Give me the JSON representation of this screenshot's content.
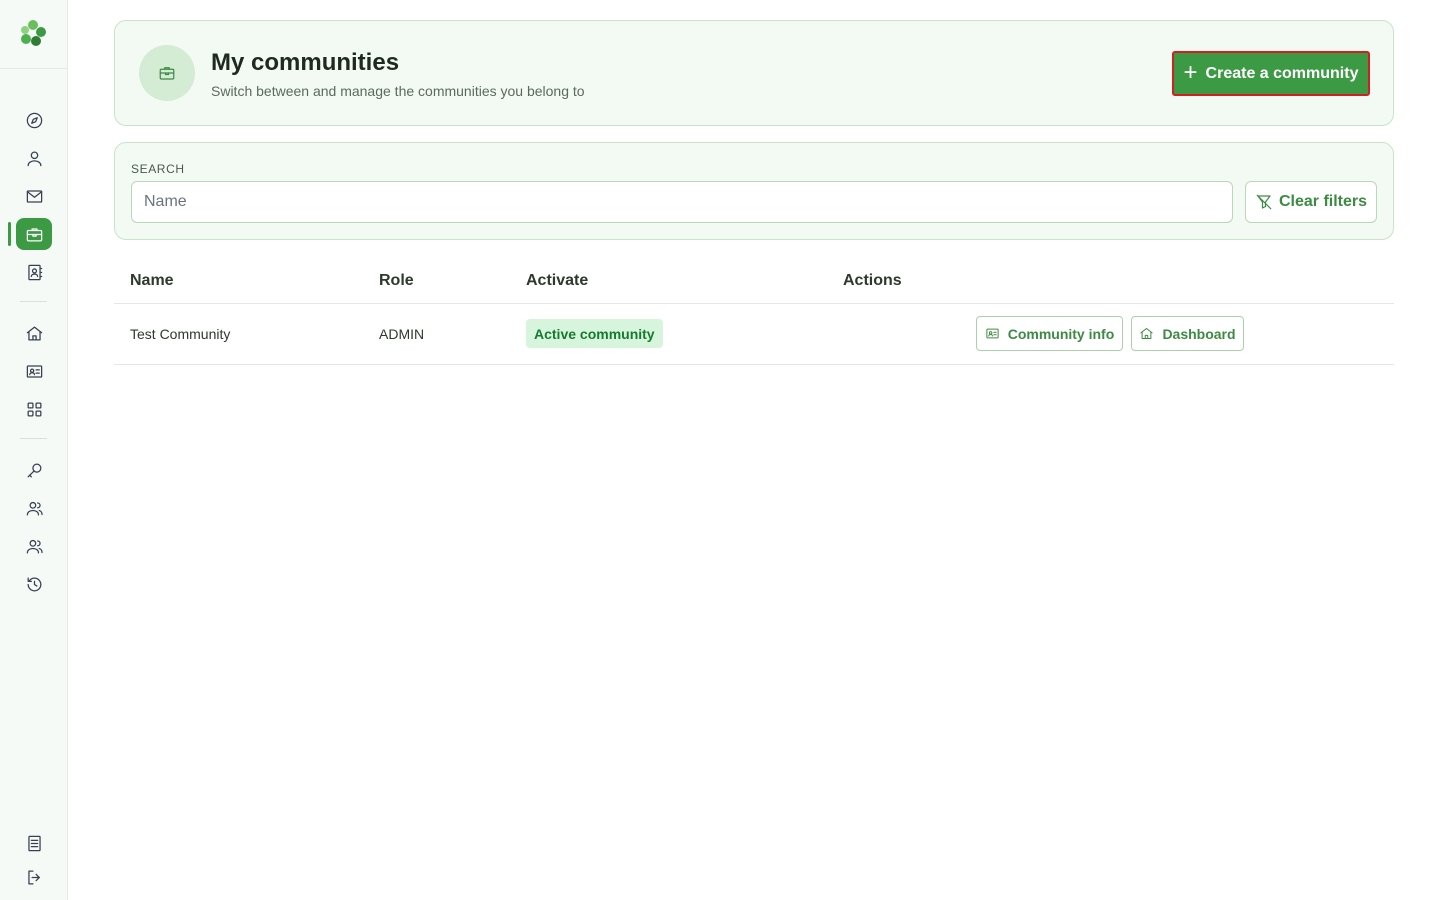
{
  "sidebar": {
    "logo_icon": "clover-logo",
    "nav_items": [
      {
        "name": "compass-icon",
        "active": false
      },
      {
        "name": "user-icon",
        "active": false
      },
      {
        "name": "mail-icon",
        "active": false
      },
      {
        "name": "briefcase-icon",
        "active": true
      },
      {
        "name": "contact-book-icon",
        "active": false
      },
      {
        "name": "home-icon",
        "active": false
      },
      {
        "name": "id-card-icon",
        "active": false
      },
      {
        "name": "grid-icon",
        "active": false
      },
      {
        "name": "key-icon",
        "active": false
      },
      {
        "name": "users-icon",
        "active": false
      },
      {
        "name": "users-group-icon",
        "active": false
      },
      {
        "name": "history-icon",
        "active": false
      }
    ],
    "bottom_items": [
      {
        "name": "document-icon"
      },
      {
        "name": "logout-icon"
      }
    ]
  },
  "header": {
    "icon": "briefcase-icon",
    "title": "My communities",
    "subtitle": "Switch between and manage the communities you belong to",
    "create_button_label": "Create a community"
  },
  "search": {
    "label": "SEARCH",
    "placeholder": "Name",
    "value": "",
    "clear_button_label": "Clear filters"
  },
  "table": {
    "columns": [
      "Name",
      "Role",
      "Activate",
      "Actions"
    ],
    "rows": [
      {
        "name": "Test Community",
        "role": "ADMIN",
        "status": "Active community",
        "actions": [
          "Community info",
          "Dashboard"
        ]
      }
    ]
  },
  "colors": {
    "accent": "#3d9a44",
    "header_bg": "#f3faf3",
    "badge_bg": "#d7f5dd",
    "badge_text": "#177a2e",
    "highlight_border": "#d21f1f"
  }
}
